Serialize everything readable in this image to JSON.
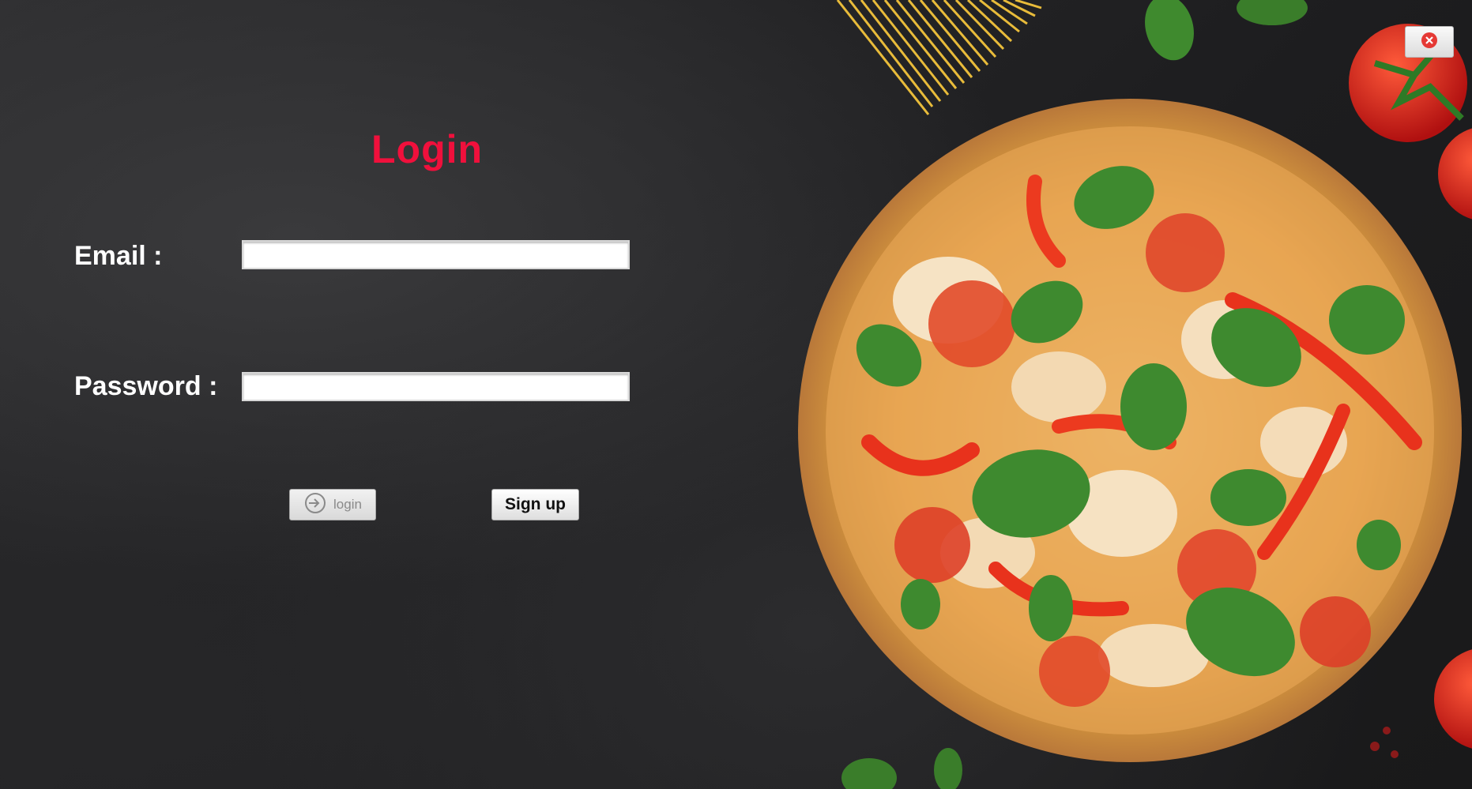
{
  "title": "Login",
  "email": {
    "label": "Email :",
    "value": "",
    "placeholder": ""
  },
  "password": {
    "label": "Password :",
    "value": "",
    "placeholder": ""
  },
  "buttons": {
    "login_label": "login",
    "signup_label": "Sign up"
  },
  "icons": {
    "login": "login-arrow-icon",
    "close": "close-icon"
  },
  "colors": {
    "title": "#f0103c",
    "background": "#202022",
    "close_icon": "#e53935"
  }
}
